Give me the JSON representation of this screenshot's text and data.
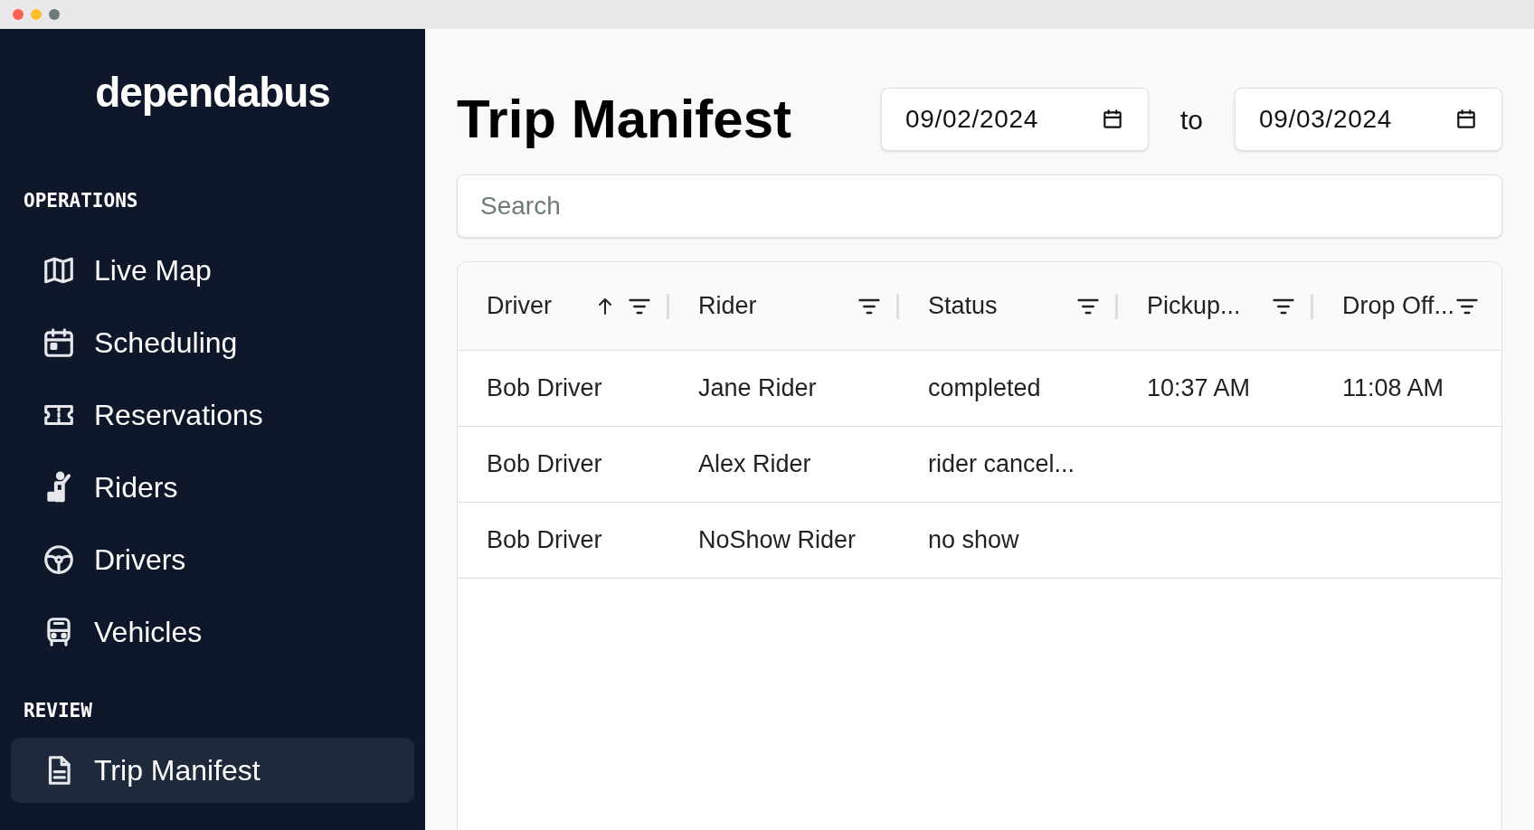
{
  "sidebar": {
    "logo": "dependabus",
    "sections": [
      {
        "heading": "OPERATIONS",
        "items": [
          {
            "label": "Live Map",
            "selected": false
          },
          {
            "label": "Scheduling",
            "selected": false
          },
          {
            "label": "Reservations",
            "selected": false
          },
          {
            "label": "Riders",
            "selected": false
          },
          {
            "label": "Drivers",
            "selected": false
          },
          {
            "label": "Vehicles",
            "selected": false
          }
        ]
      },
      {
        "heading": "REVIEW",
        "items": [
          {
            "label": "Trip Manifest",
            "selected": true
          }
        ]
      }
    ]
  },
  "page": {
    "title": "Trip Manifest",
    "date_from": "09/02/2024",
    "separator": "to",
    "date_to": "09/03/2024"
  },
  "search": {
    "placeholder": "Search"
  },
  "table": {
    "columns": [
      {
        "label": "Driver",
        "sorted": true
      },
      {
        "label": "Rider",
        "sorted": false
      },
      {
        "label": "Status",
        "sorted": false
      },
      {
        "label": "Pickup...",
        "sorted": false
      },
      {
        "label": "Drop Off...",
        "sorted": false
      }
    ],
    "rows": [
      [
        "Bob Driver",
        "Jane Rider",
        "completed",
        "10:37 AM",
        "11:08 AM"
      ],
      [
        "Bob Driver",
        "Alex Rider",
        "rider cancel...",
        "",
        ""
      ],
      [
        "Bob Driver",
        "NoShow Rider",
        "no show",
        "",
        ""
      ]
    ]
  }
}
